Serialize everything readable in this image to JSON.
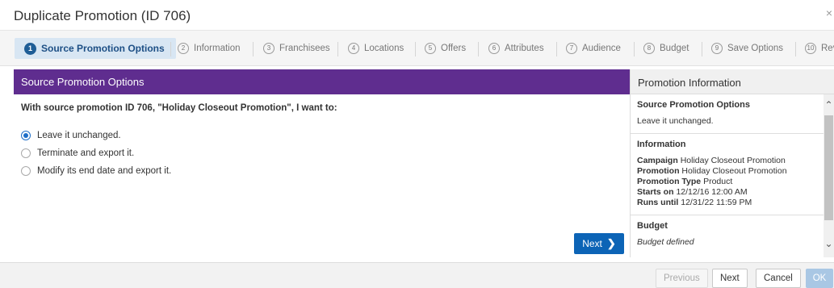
{
  "dialog": {
    "title": "Duplicate Promotion (ID 706)",
    "close_icon": "×"
  },
  "steps": [
    {
      "num": "1",
      "label": "Source Promotion Options",
      "active": true
    },
    {
      "num": "2",
      "label": "Information"
    },
    {
      "num": "3",
      "label": "Franchisees"
    },
    {
      "num": "4",
      "label": "Locations"
    },
    {
      "num": "5",
      "label": "Offers"
    },
    {
      "num": "6",
      "label": "Attributes"
    },
    {
      "num": "7",
      "label": "Audience"
    },
    {
      "num": "8",
      "label": "Budget"
    },
    {
      "num": "9",
      "label": "Save Options"
    },
    {
      "num": "10",
      "label": "Rev"
    }
  ],
  "main": {
    "panel_title": "Source Promotion Options",
    "question": "With source promotion ID 706, \"Holiday Closeout Promotion\", I want to:",
    "options": [
      {
        "label": "Leave it unchanged.",
        "checked": true
      },
      {
        "label": "Terminate and export it.",
        "checked": false
      },
      {
        "label": "Modify its end date and export it.",
        "checked": false
      }
    ],
    "next_label": "Next",
    "next_icon": "chevron-right-icon"
  },
  "info": {
    "title": "Promotion Information",
    "source_heading": "Source Promotion Options",
    "source_value": "Leave it unchanged.",
    "information_heading": "Information",
    "campaign_label": "Campaign",
    "campaign_value": "Holiday Closeout Promotion",
    "promotion_label": "Promotion",
    "promotion_value": "Holiday Closeout Promotion",
    "type_label": "Promotion Type",
    "type_value": "Product",
    "starts_label": "Starts on",
    "starts_value": "12/12/16 12:00 AM",
    "runs_label": "Runs until",
    "runs_value": "12/31/22 11:59 PM",
    "budget_heading": "Budget",
    "budget_value": "Budget defined"
  },
  "footer": {
    "previous": "Previous",
    "next": "Next",
    "cancel": "Cancel",
    "ok": "OK"
  },
  "colors": {
    "accent": "#0c64b6",
    "panel_header": "#5f2d8f",
    "active_step_bg": "#d8e6f3"
  }
}
